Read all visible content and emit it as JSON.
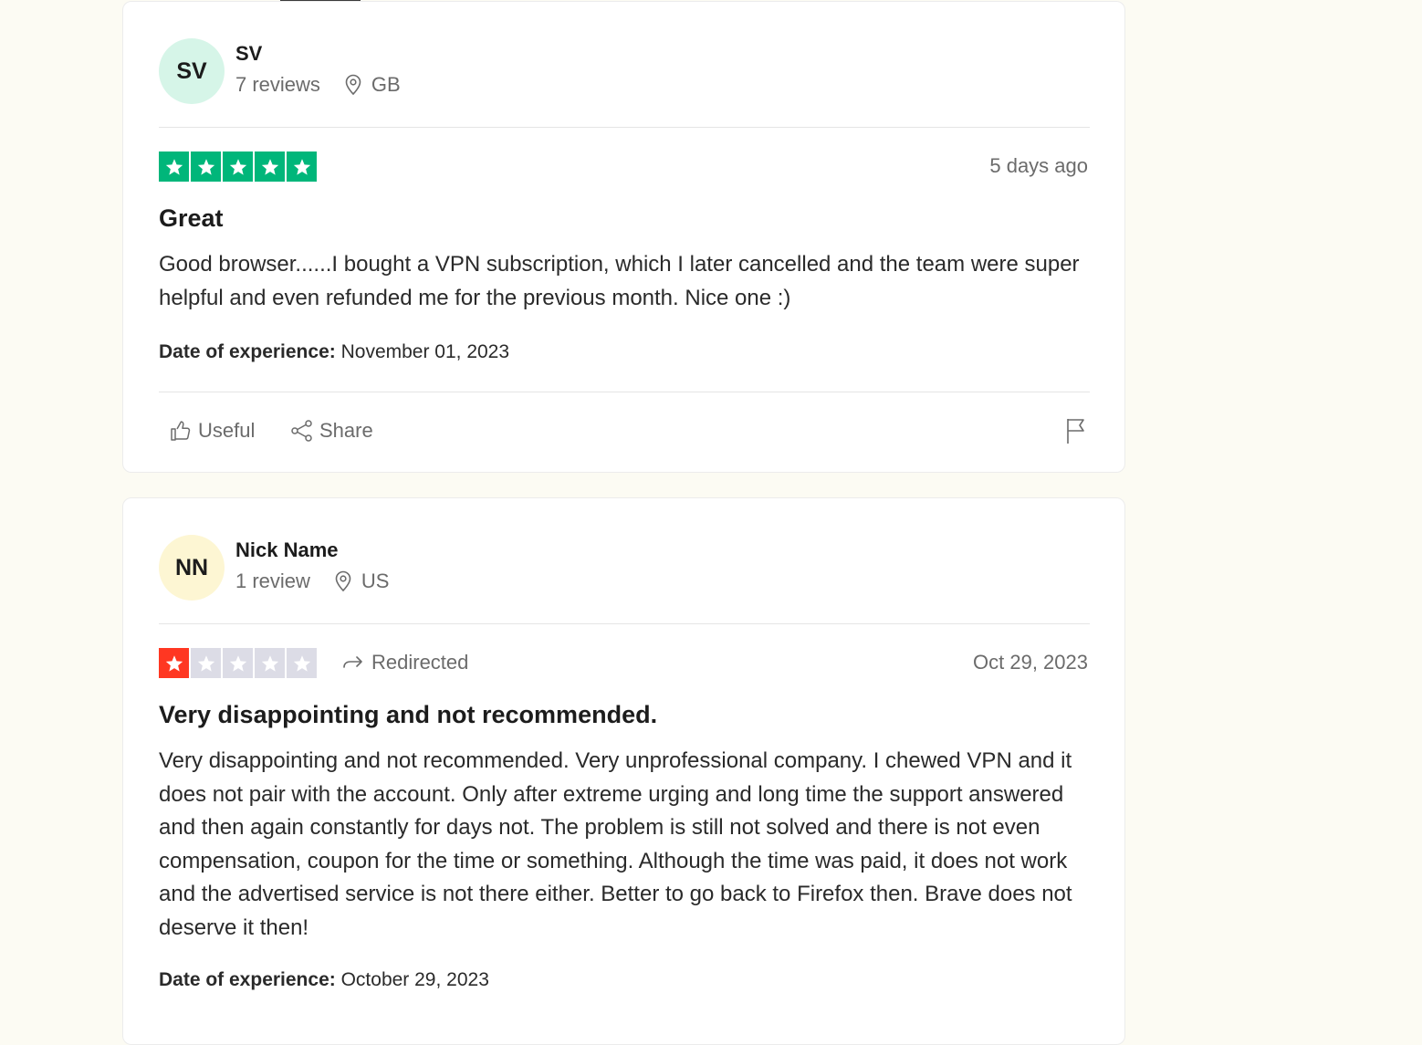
{
  "reviews": [
    {
      "avatar_initials": "SV",
      "avatar_color": "#d6f5e8",
      "name": "SV",
      "review_count": "7 reviews",
      "location": "GB",
      "rating": 5,
      "star_color": "#00b67a",
      "date": "5 days ago",
      "title": "Great",
      "body": "Good browser......I bought a VPN subscription, which I later cancelled and the team were super helpful and even refunded me for the previous month. Nice one :)",
      "experience_label": "Date of experience:",
      "experience_date": "November 01, 2023",
      "useful_label": "Useful",
      "share_label": "Share"
    },
    {
      "avatar_initials": "NN",
      "avatar_color": "#fdf6d3",
      "name": "Nick Name",
      "review_count": "1 review",
      "location": "US",
      "rating": 1,
      "star_color": "#ff3722",
      "redirected_label": "Redirected",
      "date": "Oct 29, 2023",
      "title": "Very disappointing and not recommended.",
      "body": "Very disappointing and not recommended. Very unprofessional company. I chewed VPN and it does not pair with the account. Only after extreme urging and long time the support answered and then again constantly for days not. The problem is still not solved and there is not even compensation, coupon for the time or something. Although the time was paid, it does not work and the advertised service is not there either. Better to go back to Firefox then. Brave does not deserve it then!",
      "experience_label": "Date of experience:",
      "experience_date": "October 29, 2023"
    }
  ],
  "empty_star_color": "#dcdce6"
}
